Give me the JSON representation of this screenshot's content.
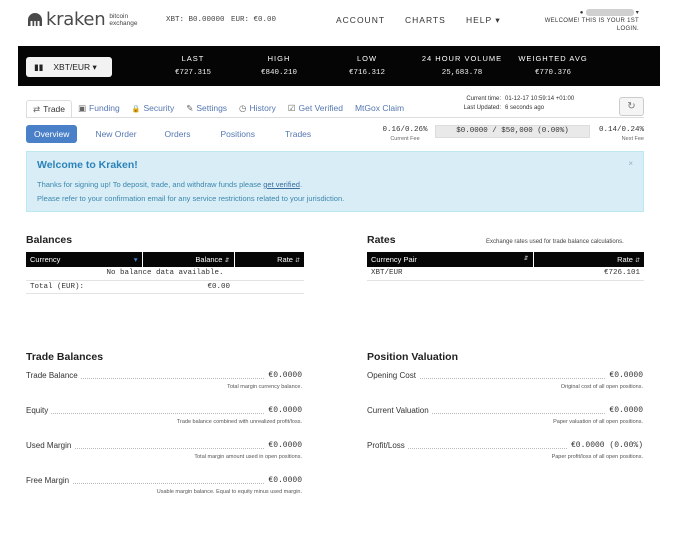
{
  "header": {
    "logo_text": "kraken",
    "logo_sub": "bitcoin exchange",
    "xbt_balance": "XBT: B0.00000",
    "eur_balance": "EUR: €0.00",
    "nav": [
      "ACCOUNT",
      "CHARTS",
      "HELP ▾"
    ],
    "user_icon": "user-icon",
    "welcome_line1": "WELCOME! THIS IS YOUR 1ST",
    "welcome_line2": "LOGIN."
  },
  "ticker": {
    "pair_label": "XBT/EUR ▾",
    "items": [
      {
        "label": "LAST",
        "value": "€727.315"
      },
      {
        "label": "HIGH",
        "value": "€840.210"
      },
      {
        "label": "LOW",
        "value": "€716.312"
      },
      {
        "label": "24 HOUR VOLUME",
        "value": "25,683.78"
      },
      {
        "label": "WEIGHTED AVG",
        "value": "€770.376"
      }
    ]
  },
  "tabs": [
    {
      "label": "Trade",
      "icon": "⇄"
    },
    {
      "label": "Funding",
      "icon": "▣"
    },
    {
      "label": "Security",
      "icon": "🔒"
    },
    {
      "label": "Settings",
      "icon": "✎"
    },
    {
      "label": "History",
      "icon": "◷"
    },
    {
      "label": "Get Verified",
      "icon": "☑"
    },
    {
      "label": "MtGox Claim",
      "icon": ""
    }
  ],
  "time_info": {
    "current_label": "Current time:",
    "current_value": "01-12-17 10:59:14 +01:00",
    "updated_label": "Last Updated:",
    "updated_value": "6 seconds ago",
    "refresh_icon": "↻"
  },
  "subnav": [
    "Overview",
    "New Order",
    "Orders",
    "Positions",
    "Trades"
  ],
  "fees": {
    "current_value": "0.16/0.26%",
    "current_label": "Current Fee",
    "volume": "$0.0000 / $50,000 (0.00%)",
    "next_value": "0.14/0.24%",
    "next_label": "Next Fee"
  },
  "alert": {
    "title": "Welcome to Kraken!",
    "line1_pre": "Thanks for signing up! To deposit, trade, and withdraw funds please ",
    "line1_link": "get verified",
    "line1_post": ".",
    "line2": "Please refer to your confirmation email for any service restrictions related to your jurisdiction.",
    "close": "×"
  },
  "balances": {
    "title": "Balances",
    "headers": [
      "Currency",
      "Balance",
      "Rate"
    ],
    "empty_text": "No balance data available.",
    "total_label": "Total (EUR):",
    "total_value": "€0.00"
  },
  "rates": {
    "title": "Rates",
    "note": "Exchange rates used for trade balance calculations.",
    "headers": [
      "Currency Pair",
      "Rate"
    ],
    "rows": [
      {
        "pair": "XBT/EUR",
        "rate": "€726.101"
      }
    ]
  },
  "trade_balances": {
    "title": "Trade Balances",
    "rows": [
      {
        "label": "Trade Balance",
        "value": "€0.0000",
        "desc": "Total margin currency balance."
      },
      {
        "label": "Equity",
        "value": "€0.0000",
        "desc": "Trade balance combined with unrealized profit/loss."
      },
      {
        "label": "Used Margin",
        "value": "€0.0000",
        "desc": "Total margin amount used in open positions."
      },
      {
        "label": "Free Margin",
        "value": "€0.0000",
        "desc": "Usable margin balance. Equal to equity minus used margin."
      }
    ]
  },
  "position_valuation": {
    "title": "Position Valuation",
    "rows": [
      {
        "label": "Opening Cost",
        "value": "€0.0000",
        "desc": "Original cost of all open positions."
      },
      {
        "label": "Current Valuation",
        "value": "€0.0000",
        "desc": "Paper valuation of all open positions."
      },
      {
        "label": "Profit/Loss",
        "value": "€0.0000 (0.00%)",
        "desc": "Paper profit/loss of all open positions."
      }
    ]
  }
}
